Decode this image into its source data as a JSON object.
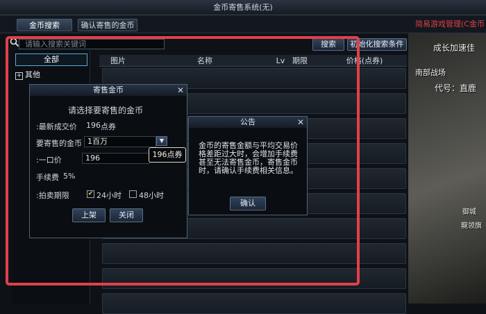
{
  "window": {
    "title": "金币寄售系统(无)"
  },
  "tabs": [
    {
      "label": "金币搜索",
      "active": true
    },
    {
      "label": "确认寄售的金币",
      "active": false
    }
  ],
  "top_notice_red": "简易游戏管理(C金币",
  "game_bg": {
    "texts": [
      "成长加速佳",
      "南部战场",
      "代号：直鹿",
      "御城",
      "龍领旗"
    ]
  },
  "search": {
    "placeholder": "请输入搜索关键词",
    "search_button": "搜索",
    "reset_button": "初始化搜索条件"
  },
  "categories": [
    {
      "label": "全部",
      "selected": true
    },
    {
      "label": "其他",
      "selected": false
    }
  ],
  "table": {
    "headers": [
      "图片",
      "名称",
      "Lv",
      "期限",
      "价格(点券)"
    ],
    "row_count": 11
  },
  "consign_dialog": {
    "title": "寄售金币",
    "subtitle": "请选择要寄售的金币",
    "latest_price_label": ":最新成交价",
    "latest_price_value": "196",
    "latest_price_unit": "点券",
    "gold_label": "要寄售的金币",
    "gold_value": "1百万",
    "fixed_price_label": ":一口价",
    "fixed_price_value": "196",
    "fee_label": "手续费",
    "fee_value": "5%",
    "period_label": ":拍卖期限",
    "period_options": [
      {
        "label": "24小时",
        "checked": true
      },
      {
        "label": "48小时",
        "checked": false
      }
    ],
    "list_button": "上架",
    "close_button": "关闭",
    "tooltip": "196点券"
  },
  "notice_dialog": {
    "title": "公告",
    "message": "金币的寄售金额与平均交易价格差距过大时，会增加手续费甚至无法寄售金币，寄售金币时，请确认手续费相关信息。",
    "confirm_button": "确认"
  },
  "colors": {
    "annotation_frame": "#e2404a",
    "accent": "#5fa7d8",
    "panel_bg": "#0a0d11"
  },
  "icons": [
    "search-icon",
    "close-icon",
    "dropdown-arrow-icon",
    "plus-icon",
    "checkbox-icon"
  ]
}
